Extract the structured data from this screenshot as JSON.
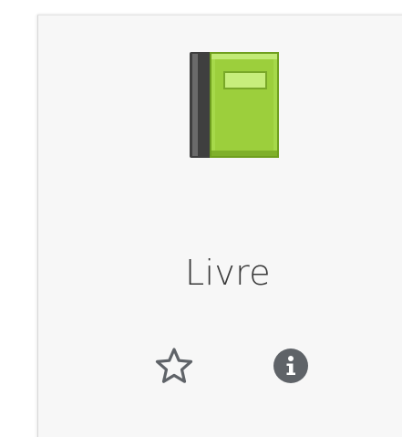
{
  "item": {
    "title": "Livre",
    "icon": "green-book-icon",
    "favorite": false
  },
  "actions": {
    "favorite_icon": "star-outline-icon",
    "info_icon": "info-circle-icon"
  },
  "colors": {
    "card_background": "#f7f7f7",
    "title_text": "#3a3a3a",
    "action_icons": "#5f6368",
    "book_cover": "#a6d94a",
    "book_spine": "#3a3a3a"
  }
}
